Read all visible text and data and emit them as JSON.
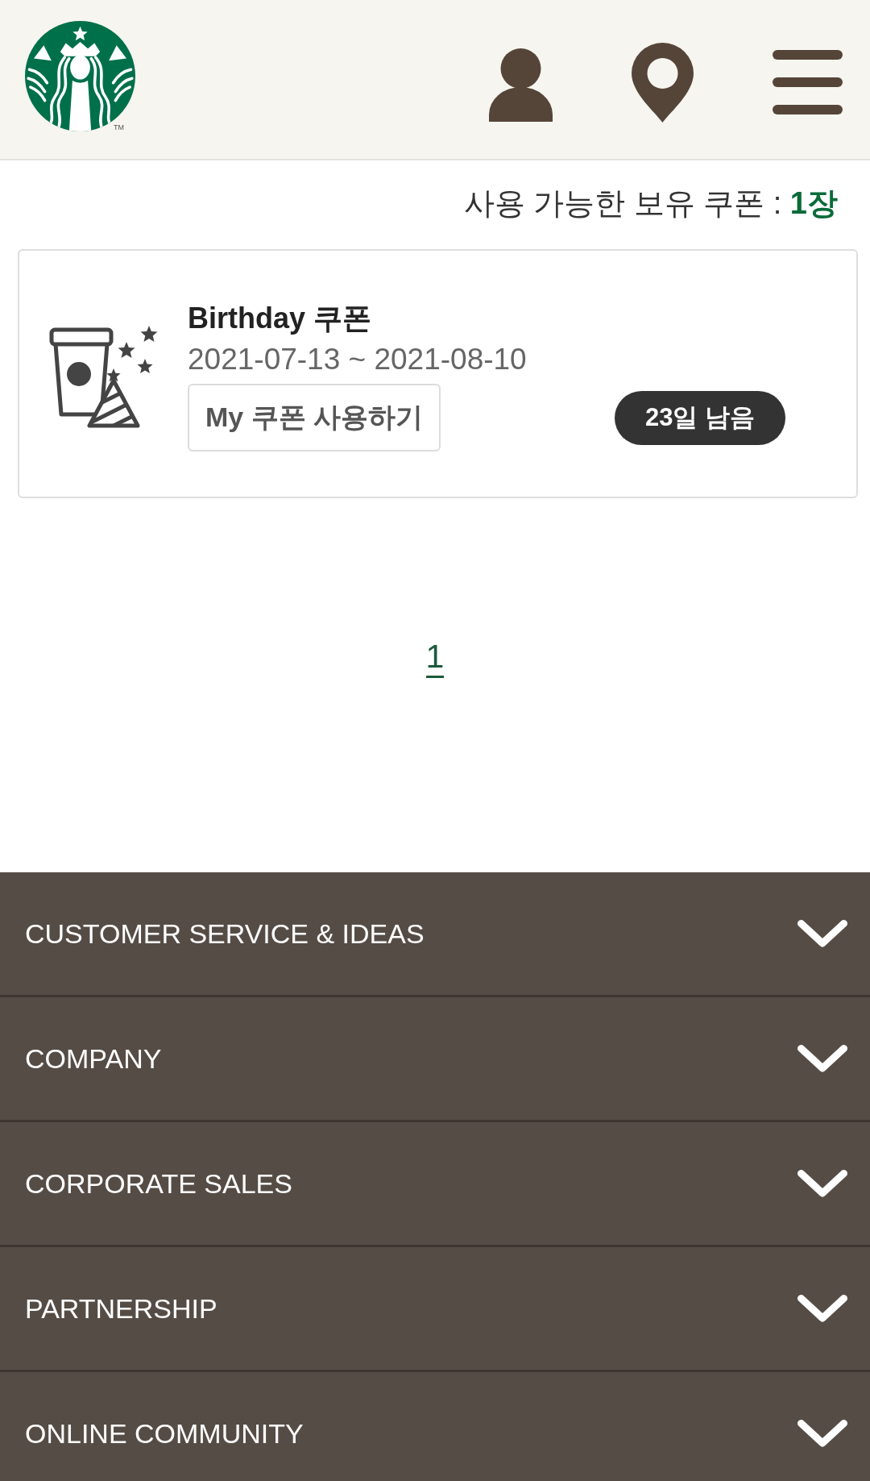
{
  "header": {
    "logo": {
      "trademark": "TM"
    },
    "buttons": [
      {
        "kind": "account"
      },
      {
        "kind": "location"
      },
      {
        "kind": "menu"
      }
    ]
  },
  "coupon_summary": "사용 가능한 보유 쿠폰 : **1장**",
  "coupons": [
    {
      "title": "Birthday 쿠폰",
      "period": "2021-07-13 ~ 2021-08-10",
      "action": "My 쿠폰 사용하기",
      "remaining": "23일 남음"
    }
  ],
  "pagination": [
    {
      "label": "1",
      "selected": true
    }
  ],
  "footer_menu": [
    {
      "label": "CUSTOMER SERVICE & IDEAS",
      "expanded": false
    },
    {
      "label": "COMPANY",
      "expanded": false
    },
    {
      "label": "CORPORATE SALES",
      "expanded": false
    },
    {
      "label": "PARTNERSHIP",
      "expanded": false
    },
    {
      "label": "ONLINE COMMUNITY",
      "expanded": false
    }
  ]
}
